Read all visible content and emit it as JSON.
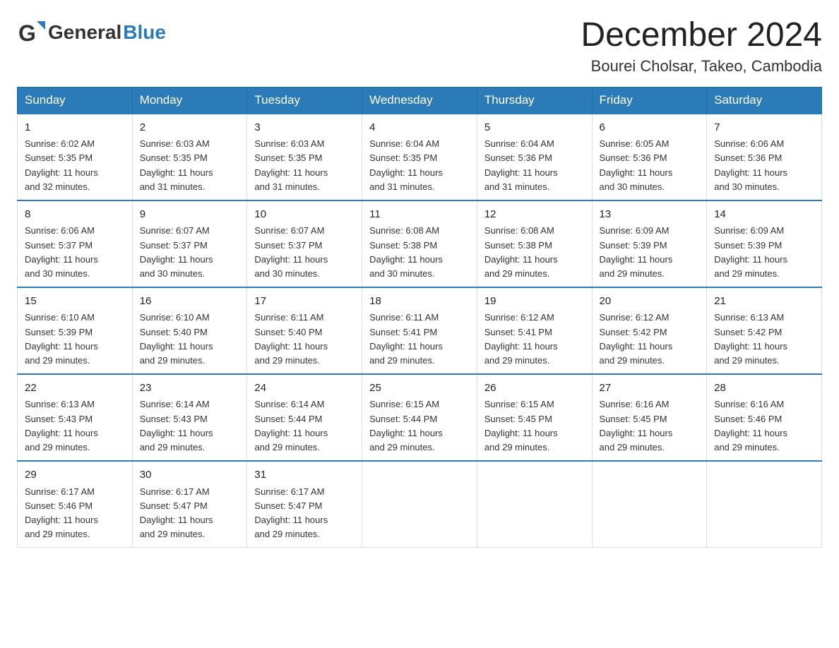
{
  "header": {
    "logo": {
      "general": "General",
      "blue": "Blue"
    },
    "title": "December 2024",
    "location": "Bourei Cholsar, Takeo, Cambodia"
  },
  "days_of_week": [
    "Sunday",
    "Monday",
    "Tuesday",
    "Wednesday",
    "Thursday",
    "Friday",
    "Saturday"
  ],
  "weeks": [
    [
      {
        "day": "1",
        "sunrise": "6:02 AM",
        "sunset": "5:35 PM",
        "daylight": "11 hours and 32 minutes."
      },
      {
        "day": "2",
        "sunrise": "6:03 AM",
        "sunset": "5:35 PM",
        "daylight": "11 hours and 31 minutes."
      },
      {
        "day": "3",
        "sunrise": "6:03 AM",
        "sunset": "5:35 PM",
        "daylight": "11 hours and 31 minutes."
      },
      {
        "day": "4",
        "sunrise": "6:04 AM",
        "sunset": "5:35 PM",
        "daylight": "11 hours and 31 minutes."
      },
      {
        "day": "5",
        "sunrise": "6:04 AM",
        "sunset": "5:36 PM",
        "daylight": "11 hours and 31 minutes."
      },
      {
        "day": "6",
        "sunrise": "6:05 AM",
        "sunset": "5:36 PM",
        "daylight": "11 hours and 30 minutes."
      },
      {
        "day": "7",
        "sunrise": "6:06 AM",
        "sunset": "5:36 PM",
        "daylight": "11 hours and 30 minutes."
      }
    ],
    [
      {
        "day": "8",
        "sunrise": "6:06 AM",
        "sunset": "5:37 PM",
        "daylight": "11 hours and 30 minutes."
      },
      {
        "day": "9",
        "sunrise": "6:07 AM",
        "sunset": "5:37 PM",
        "daylight": "11 hours and 30 minutes."
      },
      {
        "day": "10",
        "sunrise": "6:07 AM",
        "sunset": "5:37 PM",
        "daylight": "11 hours and 30 minutes."
      },
      {
        "day": "11",
        "sunrise": "6:08 AM",
        "sunset": "5:38 PM",
        "daylight": "11 hours and 30 minutes."
      },
      {
        "day": "12",
        "sunrise": "6:08 AM",
        "sunset": "5:38 PM",
        "daylight": "11 hours and 29 minutes."
      },
      {
        "day": "13",
        "sunrise": "6:09 AM",
        "sunset": "5:39 PM",
        "daylight": "11 hours and 29 minutes."
      },
      {
        "day": "14",
        "sunrise": "6:09 AM",
        "sunset": "5:39 PM",
        "daylight": "11 hours and 29 minutes."
      }
    ],
    [
      {
        "day": "15",
        "sunrise": "6:10 AM",
        "sunset": "5:39 PM",
        "daylight": "11 hours and 29 minutes."
      },
      {
        "day": "16",
        "sunrise": "6:10 AM",
        "sunset": "5:40 PM",
        "daylight": "11 hours and 29 minutes."
      },
      {
        "day": "17",
        "sunrise": "6:11 AM",
        "sunset": "5:40 PM",
        "daylight": "11 hours and 29 minutes."
      },
      {
        "day": "18",
        "sunrise": "6:11 AM",
        "sunset": "5:41 PM",
        "daylight": "11 hours and 29 minutes."
      },
      {
        "day": "19",
        "sunrise": "6:12 AM",
        "sunset": "5:41 PM",
        "daylight": "11 hours and 29 minutes."
      },
      {
        "day": "20",
        "sunrise": "6:12 AM",
        "sunset": "5:42 PM",
        "daylight": "11 hours and 29 minutes."
      },
      {
        "day": "21",
        "sunrise": "6:13 AM",
        "sunset": "5:42 PM",
        "daylight": "11 hours and 29 minutes."
      }
    ],
    [
      {
        "day": "22",
        "sunrise": "6:13 AM",
        "sunset": "5:43 PM",
        "daylight": "11 hours and 29 minutes."
      },
      {
        "day": "23",
        "sunrise": "6:14 AM",
        "sunset": "5:43 PM",
        "daylight": "11 hours and 29 minutes."
      },
      {
        "day": "24",
        "sunrise": "6:14 AM",
        "sunset": "5:44 PM",
        "daylight": "11 hours and 29 minutes."
      },
      {
        "day": "25",
        "sunrise": "6:15 AM",
        "sunset": "5:44 PM",
        "daylight": "11 hours and 29 minutes."
      },
      {
        "day": "26",
        "sunrise": "6:15 AM",
        "sunset": "5:45 PM",
        "daylight": "11 hours and 29 minutes."
      },
      {
        "day": "27",
        "sunrise": "6:16 AM",
        "sunset": "5:45 PM",
        "daylight": "11 hours and 29 minutes."
      },
      {
        "day": "28",
        "sunrise": "6:16 AM",
        "sunset": "5:46 PM",
        "daylight": "11 hours and 29 minutes."
      }
    ],
    [
      {
        "day": "29",
        "sunrise": "6:17 AM",
        "sunset": "5:46 PM",
        "daylight": "11 hours and 29 minutes."
      },
      {
        "day": "30",
        "sunrise": "6:17 AM",
        "sunset": "5:47 PM",
        "daylight": "11 hours and 29 minutes."
      },
      {
        "day": "31",
        "sunrise": "6:17 AM",
        "sunset": "5:47 PM",
        "daylight": "11 hours and 29 minutes."
      },
      null,
      null,
      null,
      null
    ]
  ],
  "labels": {
    "sunrise": "Sunrise:",
    "sunset": "Sunset:",
    "daylight": "Daylight:"
  }
}
